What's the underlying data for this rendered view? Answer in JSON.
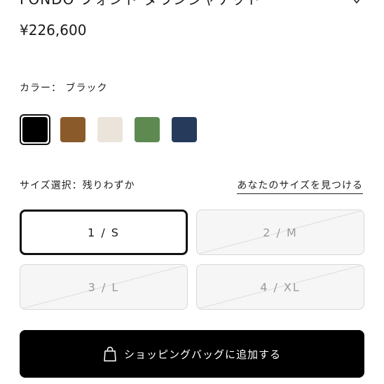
{
  "product": {
    "title": "FONDO フォンド ダウンジャケット",
    "price": "¥226,600"
  },
  "color": {
    "label": "カラー： ブラック",
    "swatches": [
      {
        "name": "black",
        "hex": "#000000",
        "selected": true
      },
      {
        "name": "brown",
        "hex": "#8a5a2a",
        "selected": false
      },
      {
        "name": "ivory",
        "hex": "#ebe4da",
        "selected": false
      },
      {
        "name": "green",
        "hex": "#5e8a52",
        "selected": false
      },
      {
        "name": "navy",
        "hex": "#263a5c",
        "selected": false
      }
    ]
  },
  "size": {
    "label": "サイズ選択：残りわずか",
    "guide_link": "あなたのサイズを見つける",
    "options": [
      {
        "label": "1 / S",
        "available": true,
        "selected": true
      },
      {
        "label": "2 / M",
        "available": false,
        "selected": false
      },
      {
        "label": "3 / L",
        "available": false,
        "selected": false
      },
      {
        "label": "4 / XL",
        "available": false,
        "selected": false
      }
    ]
  },
  "actions": {
    "add_to_bag": "ショッピングバッグに追加する"
  },
  "icons": {
    "wishlist": "heart-icon",
    "bag": "shopping-bag-icon"
  }
}
